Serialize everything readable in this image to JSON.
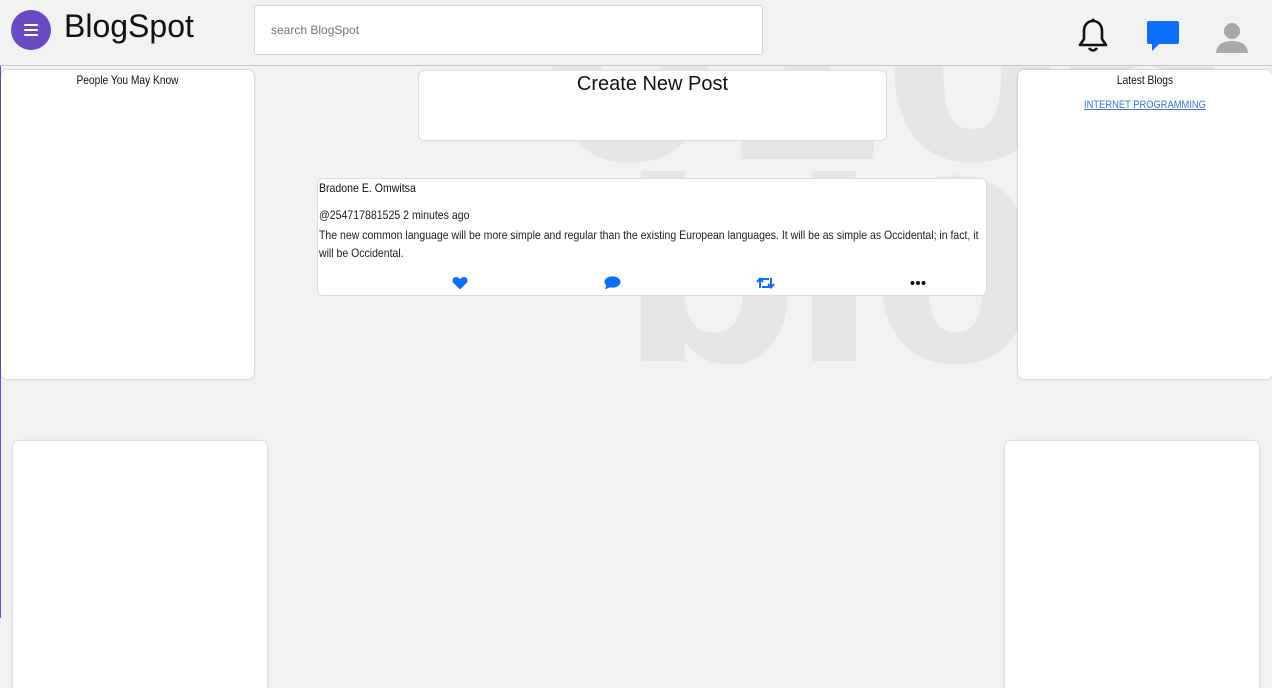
{
  "header": {
    "brand": "BlogSpot",
    "search_placeholder": "search BlogSpot",
    "icons": [
      "menu-icon",
      "bell-icon",
      "chat-icon",
      "user-avatar-icon"
    ],
    "accent_color": "#6a4bc4",
    "chat_color": "#0d6efd"
  },
  "watermark": {
    "line1": "0106",
    "line2": "bl0"
  },
  "sidebar_left": {
    "title": "People You May Know"
  },
  "sidebar_right": {
    "title": "Latest Blogs",
    "links": [
      "INTERNET PROGRAMMING"
    ]
  },
  "create_post": {
    "label": "Create New Post"
  },
  "post": {
    "author": "Bradone E. Omwitsa",
    "handle": "@254717881525",
    "time": "2 minutes ago",
    "body": "The new common language will be more simple and regular than the existing European languages. It will be as simple as Occidental; in fact, it will be Occidental.",
    "actions": [
      "heart-icon",
      "comment-icon",
      "retweet-icon",
      "more-icon"
    ],
    "action_color": "#0d6efd"
  }
}
